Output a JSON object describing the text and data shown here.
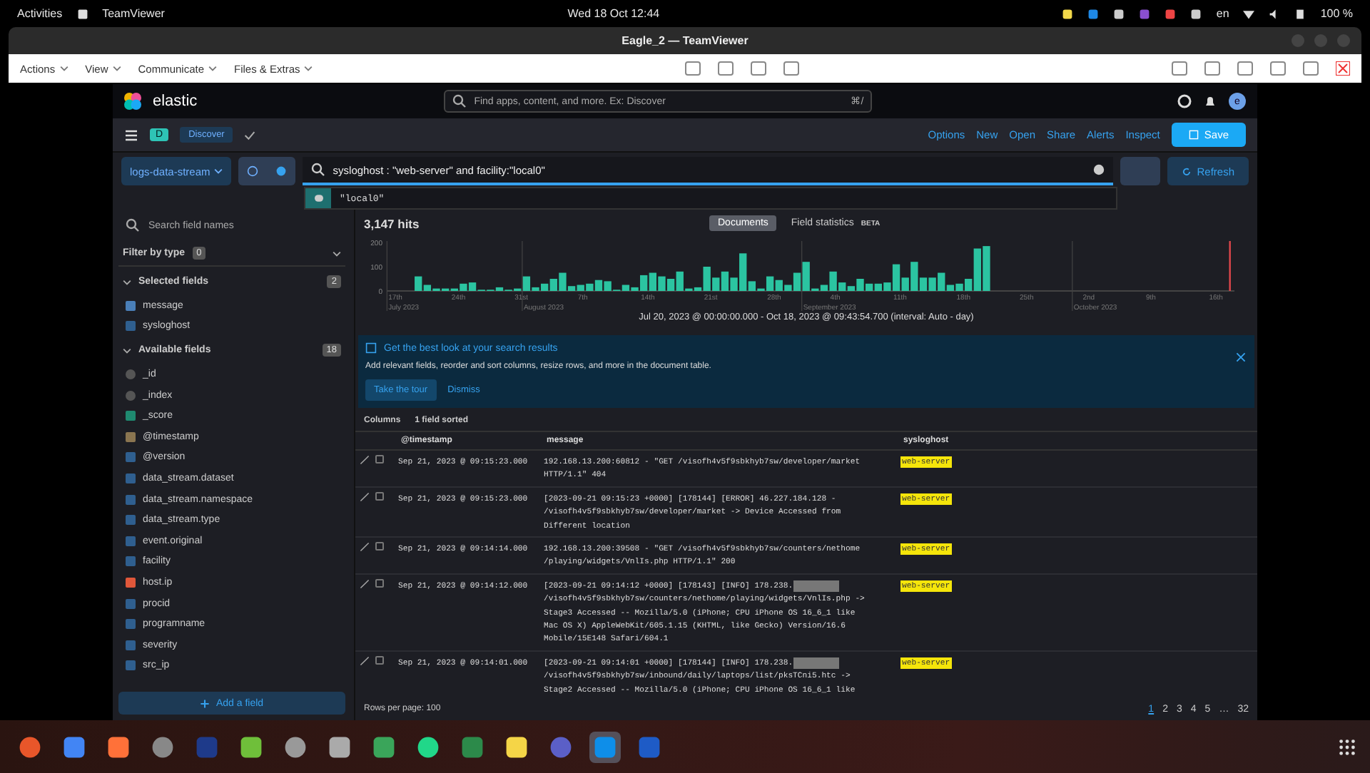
{
  "system_bar": {
    "activities": "Activities",
    "app": "TeamViewer",
    "clock": "Wed 18 Oct  12:44",
    "language": "en",
    "battery": "100 %"
  },
  "window": {
    "title": "Eagle_2 — TeamViewer"
  },
  "toolbar": {
    "menus": [
      "Actions",
      "View",
      "Communicate",
      "Files & Extras"
    ]
  },
  "kibana": {
    "logo": "elastic",
    "global_search": {
      "placeholder": "Find apps, content, and more. Ex: Discover",
      "shortcut": "⌘/"
    },
    "avatar": "e",
    "app_badge": "D",
    "breadcrumb": "Discover",
    "actions": [
      "Options",
      "New",
      "Open",
      "Share",
      "Alerts",
      "Inspect"
    ],
    "save": "Save",
    "data_view": "logs-data-stream",
    "query": "sysloghost : \"web-server\" and facility:\"local0\"",
    "suggestion": "\"local0\"",
    "refresh": "Refresh",
    "sidebar": {
      "search": {
        "placeholder": "Search field names"
      },
      "filter": {
        "label": "Filter by type",
        "count": "0"
      },
      "selected": {
        "title": "Selected fields",
        "count": "2",
        "fields": [
          {
            "name": "message",
            "kind": "text"
          },
          {
            "name": "sysloghost",
            "kind": "keyword"
          }
        ]
      },
      "available": {
        "title": "Available fields",
        "count": "18",
        "fields": [
          {
            "name": "_id",
            "kind": "id"
          },
          {
            "name": "_index",
            "kind": "id"
          },
          {
            "name": "_score",
            "kind": "number"
          },
          {
            "name": "@timestamp",
            "kind": "date"
          },
          {
            "name": "@version",
            "kind": "keyword"
          },
          {
            "name": "data_stream.dataset",
            "kind": "keyword"
          },
          {
            "name": "data_stream.namespace",
            "kind": "keyword"
          },
          {
            "name": "data_stream.type",
            "kind": "keyword"
          },
          {
            "name": "event.original",
            "kind": "keyword"
          },
          {
            "name": "facility",
            "kind": "keyword"
          },
          {
            "name": "host.ip",
            "kind": "ip"
          },
          {
            "name": "procid",
            "kind": "keyword"
          },
          {
            "name": "programname",
            "kind": "keyword"
          },
          {
            "name": "severity",
            "kind": "keyword"
          },
          {
            "name": "src_ip",
            "kind": "keyword"
          }
        ]
      },
      "add_field": "Add a field"
    },
    "hits": "3,147 hits",
    "view_tabs": [
      {
        "label": "Documents",
        "selected": true
      },
      {
        "label": "Field statistics",
        "selected": false,
        "badge": "BETA"
      }
    ],
    "histogram": {
      "chart_data": {
        "type": "bar",
        "ylim": [
          0,
          200
        ],
        "yticks": [
          0,
          100,
          200
        ],
        "categories": [
          "17th",
          null,
          null,
          null,
          null,
          null,
          null,
          "24th",
          null,
          null,
          null,
          null,
          null,
          null,
          "31st",
          null,
          null,
          null,
          null,
          null,
          null,
          "7th",
          null,
          null,
          null,
          null,
          null,
          null,
          "14th",
          null,
          null,
          null,
          null,
          null,
          null,
          "21st",
          null,
          null,
          null,
          null,
          null,
          null,
          "28th",
          null,
          null,
          null,
          null,
          null,
          null,
          "4th",
          null,
          null,
          null,
          null,
          null,
          null,
          "11th",
          null,
          null,
          null,
          null,
          null,
          null,
          "18th",
          null,
          null,
          null,
          null,
          null,
          null,
          "25th",
          null,
          null,
          null,
          null,
          null,
          null,
          "2nd",
          null,
          null,
          null,
          null,
          null,
          null,
          "9th",
          null,
          null,
          null,
          null,
          null,
          null,
          "16th",
          null,
          null
        ],
        "series": [
          {
            "color": "#2bc4a1",
            "values": [
              null,
              null,
              null,
              60,
              25,
              10,
              10,
              10,
              30,
              35,
              5,
              5,
              15,
              5,
              10,
              60,
              15,
              30,
              50,
              75,
              20,
              25,
              30,
              45,
              40,
              5,
              25,
              15,
              65,
              75,
              60,
              50,
              80,
              10,
              15,
              100,
              55,
              80,
              55,
              155,
              40,
              10,
              60,
              45,
              25,
              75,
              120,
              10,
              25,
              80,
              35,
              20,
              50,
              30,
              30,
              35,
              110,
              55,
              120,
              55,
              55,
              75,
              25,
              30,
              50,
              175,
              185,
              null,
              null,
              null,
              null,
              null,
              null,
              null,
              null,
              null,
              null,
              null,
              null,
              null,
              null,
              null,
              null,
              null,
              null,
              null,
              null,
              null,
              null,
              null,
              null,
              null,
              null,
              null
            ]
          }
        ],
        "annotations": [
          "July 2023",
          "August 2023",
          "September 2023",
          "October 2023"
        ]
      },
      "range": "Jul 20, 2023 @ 00:00:00.000 - Oct 18, 2023 @ 09:43:54.700 (interval: Auto - day)"
    },
    "callout": {
      "title": "Get the best look at your search results",
      "text": "Add relevant fields, reorder and sort columns, resize rows, and more in the document table.",
      "primary": "Take the tour",
      "secondary": "Dismiss"
    },
    "grid_toolbar": {
      "columns": "Columns",
      "sorted": "1 field sorted"
    },
    "table": {
      "columns": [
        "@timestamp",
        "message",
        "sysloghost"
      ],
      "rows": [
        {
          "timestamp": "Sep 21, 2023 @ 09:15:23.000",
          "lines": [
            "192.168.13.200:60812 - \"GET /visofh4v5f9sbkhyb7sw/developer/market",
            "HTTP/1.1\" 404"
          ],
          "redacted": false,
          "checked": false,
          "host": "web-server"
        },
        {
          "timestamp": "Sep 21, 2023 @ 09:15:23.000",
          "lines": [
            "[2023-09-21 09:15:23 +0000] [178144] [ERROR] 46.227.184.128 -",
            "/visofh4v5f9sbkhyb7sw/developer/market -> Device Accessed from",
            "Different location"
          ],
          "redacted": false,
          "checked": false,
          "host": "web-server"
        },
        {
          "timestamp": "Sep 21, 2023 @ 09:14:14.000",
          "lines": [
            "192.168.13.200:39508 - \"GET /visofh4v5f9sbkhyb7sw/counters/nethome",
            "/playing/widgets/VnlIs.php HTTP/1.1\" 200"
          ],
          "redacted": false,
          "checked": false,
          "host": "web-server"
        },
        {
          "timestamp": "Sep 21, 2023 @ 09:14:12.000",
          "lines": [
            "[2023-09-21 09:14:12 +0000] [178143] [INFO] 178.238.",
            "/visofh4v5f9sbkhyb7sw/counters/nethome/playing/widgets/VnlIs.php ->",
            "Stage3 Accessed -- Mozilla/5.0 (iPhone; CPU iPhone OS 16_6_1 like",
            "Mac OS X) AppleWebKit/605.1.15 (KHTML, like Gecko) Version/16.6",
            "Mobile/15E148 Safari/604.1"
          ],
          "redacted": true,
          "checked": false,
          "host": "web-server"
        },
        {
          "timestamp": "Sep 21, 2023 @ 09:14:01.000",
          "lines": [
            "[2023-09-21 09:14:01 +0000] [178144] [INFO] 178.238.",
            "/visofh4v5f9sbkhyb7sw/inbound/daily/laptops/list/pksTCni5.htc ->",
            "Stage2 Accessed -- Mozilla/5.0 (iPhone; CPU iPhone OS 16_6_1 like"
          ],
          "redacted": true,
          "checked": false,
          "host": "web-server"
        }
      ]
    },
    "footer": {
      "rows_per_page": "Rows per page: 100",
      "pages": [
        {
          "label": "1",
          "selected": true
        },
        {
          "label": "2",
          "selected": false
        },
        {
          "label": "3",
          "selected": false
        },
        {
          "label": "4",
          "selected": false
        },
        {
          "label": "5",
          "selected": false
        },
        {
          "label": "…",
          "selected": false
        },
        {
          "label": "32",
          "selected": false
        }
      ]
    }
  },
  "taskbar": {
    "apps": [
      {
        "selected": false
      },
      {
        "selected": false
      },
      {
        "selected": false
      },
      {
        "selected": false
      },
      {
        "selected": false
      },
      {
        "selected": false
      },
      {
        "selected": false
      },
      {
        "selected": false
      },
      {
        "selected": false
      },
      {
        "selected": false
      },
      {
        "selected": false
      },
      {
        "selected": false
      },
      {
        "selected": false
      },
      {
        "selected": true
      },
      {
        "selected": false
      }
    ]
  }
}
